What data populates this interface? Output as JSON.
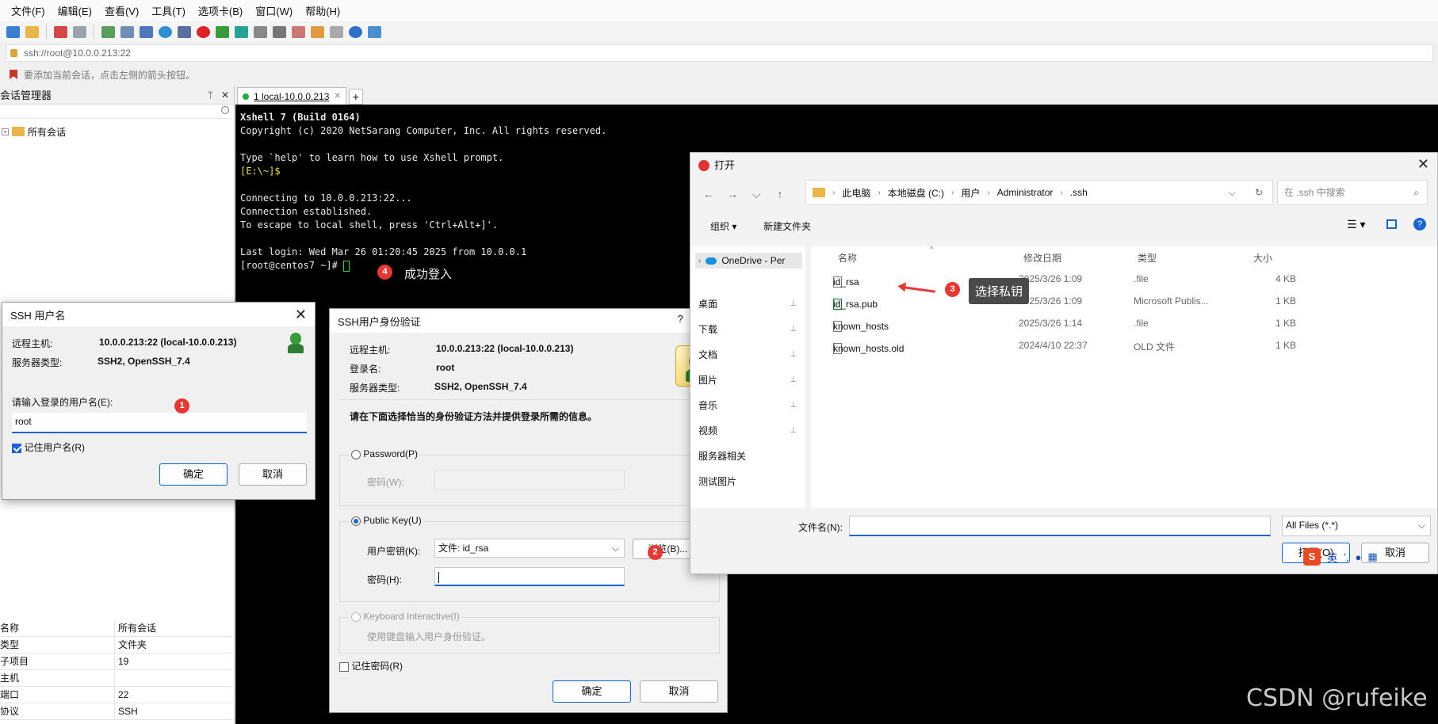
{
  "menu": [
    "文件(F)",
    "编辑(E)",
    "查看(V)",
    "工具(T)",
    "选项卡(B)",
    "窗口(W)",
    "帮助(H)"
  ],
  "address": "ssh://root@10.0.0.213:22",
  "hint": "要添加当前会话，点击左侧的箭头按钮。",
  "session_manager": {
    "title": "会话管理器",
    "pin": "ᛘ",
    "close": "✕",
    "tree_root": "所有会话",
    "props": [
      {
        "k": "名称",
        "v": "所有会话"
      },
      {
        "k": "类型",
        "v": "文件夹"
      },
      {
        "k": "子项目",
        "v": "19"
      },
      {
        "k": "主机",
        "v": ""
      },
      {
        "k": "端口",
        "v": "22"
      },
      {
        "k": "协议",
        "v": "SSH"
      }
    ]
  },
  "tab": {
    "label": "1 local-10.0.0.213",
    "close": "✕",
    "add": "+"
  },
  "terminal": {
    "lines": [
      "Xshell 7 (Build 0164)",
      "Copyright (c) 2020 NetSarang Computer, Inc. All rights reserved.",
      "",
      "Type `help' to learn how to use Xshell prompt.",
      "[E:\\~]$",
      "",
      "Connecting to 10.0.0.213:22...",
      "Connection established.",
      "To escape to local shell, press 'Ctrl+Alt+]'.",
      "",
      "Last login: Wed Mar 26 01:20:45 2025 from 10.0.0.1",
      "[root@centos7 ~]# "
    ]
  },
  "annotations": {
    "b1": "1",
    "b2": "2",
    "b3": "3",
    "b4": "4",
    "success_login": "成功登入",
    "select_key": "选择私钥"
  },
  "ssh_user_dialog": {
    "title": "SSH 用户名",
    "remote_host_label": "远程主机:",
    "remote_host": "10.0.0.213:22 (local-10.0.0.213)",
    "server_type_label": "服务器类型:",
    "server_type": "SSH2, OpenSSH_7.4",
    "prompt": "请输入登录的用户名(E):",
    "username": "root",
    "remember": "记住用户名(R)",
    "ok": "确定",
    "cancel": "取消"
  },
  "auth_dialog": {
    "title": "SSH用户身份验证",
    "help": "?",
    "remote_host_label": "远程主机:",
    "remote_host": "10.0.0.213:22 (local-10.0.0.213)",
    "login_label": "登录名:",
    "login": "root",
    "server_type_label": "服务器类型:",
    "server_type": "SSH2, OpenSSH_7.4",
    "instruction": "请在下面选择恰当的身份验证方法并提供登录所需的信息。",
    "password_opt": "Password(P)",
    "password_label": "密码(W):",
    "pubkey_opt": "Public Key(U)",
    "user_key_label": "用户密钥(K):",
    "user_key": "文件: id_rsa",
    "browse": "浏览(B)...",
    "passphrase_label": "密码(H):",
    "kbd_opt": "Keyboard Interactive(I)",
    "kbd_desc": "使用键盘输入用户身份验证。",
    "remember": "记住密码(R)",
    "ok": "确定",
    "cancel": "取消"
  },
  "open_dialog": {
    "title": "打开",
    "crumbs": [
      "此电脑",
      "本地磁盘 (C:)",
      "用户",
      "Administrator",
      ".ssh"
    ],
    "search_placeholder": "在 .ssh 中搜索",
    "organize": "组织 ▾",
    "new_folder": "新建文件夹",
    "nav": [
      {
        "label": "OneDrive - Per",
        "pin": ""
      },
      {
        "label": "桌面",
        "pin": "📌"
      },
      {
        "label": "下载",
        "pin": "📌"
      },
      {
        "label": "文档",
        "pin": "📌"
      },
      {
        "label": "图片",
        "pin": "📌"
      },
      {
        "label": "音乐",
        "pin": "📌"
      },
      {
        "label": "视频",
        "pin": "📌"
      },
      {
        "label": "服务器相关",
        "pin": ""
      },
      {
        "label": "测试图片",
        "pin": ""
      }
    ],
    "columns": [
      "名称",
      "修改日期",
      "类型",
      "大小"
    ],
    "files": [
      {
        "name": "id_rsa",
        "date": "2025/3/26 1:09",
        "type": ".file",
        "size": "4 KB",
        "icon": "file-icon"
      },
      {
        "name": "id_rsa.pub",
        "date": "2025/3/26 1:09",
        "type": "Microsoft Publis...",
        "size": "1 KB",
        "icon": "publisher-file-icon"
      },
      {
        "name": "known_hosts",
        "date": "2025/3/26 1:14",
        "type": ".file",
        "size": "1 KB",
        "icon": "file-icon"
      },
      {
        "name": "known_hosts.old",
        "date": "2024/4/10 22:37",
        "type": "OLD 文件",
        "size": "1 KB",
        "icon": "file-icon"
      }
    ],
    "filename_label": "文件名(N):",
    "filename": "",
    "filter": "All Files (*.*)",
    "open": "打开(O)",
    "cancel": "取消"
  },
  "ime": {
    "s": "S",
    "lang": "英"
  },
  "watermark": "CSDN @rufeike"
}
